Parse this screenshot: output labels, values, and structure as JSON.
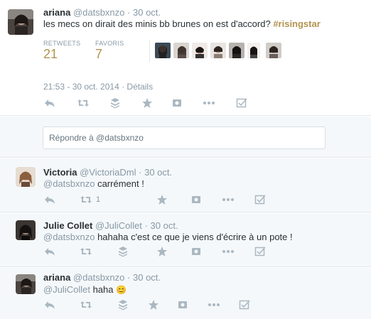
{
  "main_tweet": {
    "name": "ariana",
    "handle": "@datsbxnzo",
    "dot": "·",
    "date": "30 oct.",
    "text_before": "les mecs on dirait des minis bb brunes on est d'accord? ",
    "hashtag": "#risingstar",
    "stats": {
      "retweets_label": "RETWEETS",
      "retweets_value": "21",
      "favorites_label": "FAVORIS",
      "favorites_value": "7"
    },
    "timestamp": "21:53 - 30 oct. 2014 · Détails"
  },
  "reply_box": {
    "placeholder": "Répondre à @datsbxnzo"
  },
  "replies": [
    {
      "name": "Victoria",
      "handle": "@VictoriaDml",
      "dot": "·",
      "date": "30 oct.",
      "mention": "@datsbxnzo",
      "text": " carrément !",
      "retweet_count": "1"
    },
    {
      "name": "Julie Collet",
      "handle": "@JuliCollet",
      "dot": "·",
      "date": "30 oct.",
      "mention": "@datsbxnzo",
      "text": " hahaha c'est ce que je viens d'écrire à un pote !"
    },
    {
      "name": "ariana",
      "handle": "@datsbxnzo",
      "dot": "·",
      "date": "30 oct.",
      "mention": "@JuliCollet",
      "text": " haha",
      "emoji": "😊"
    }
  ],
  "colors": {
    "accent": "#b3934f",
    "muted": "#8899a6",
    "icon": "#aab8c2",
    "border": "#e1e8ed",
    "bg_light": "#f5f8fa"
  }
}
